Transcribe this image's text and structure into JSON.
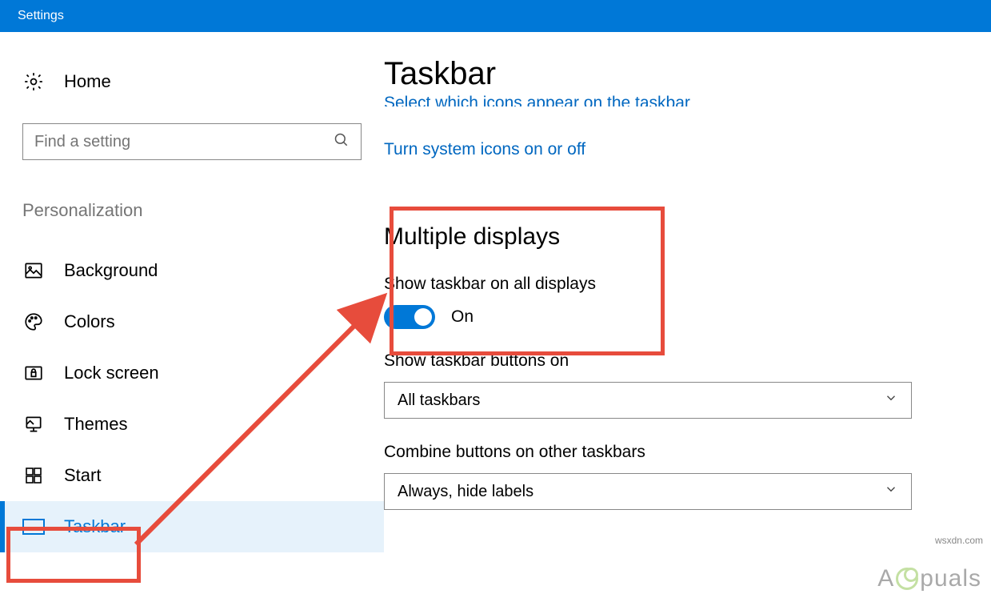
{
  "window": {
    "title": "Settings"
  },
  "sidebar": {
    "home": "Home",
    "search_placeholder": "Find a setting",
    "section": "Personalization",
    "items": [
      {
        "label": "Background"
      },
      {
        "label": "Colors"
      },
      {
        "label": "Lock screen"
      },
      {
        "label": "Themes"
      },
      {
        "label": "Start"
      },
      {
        "label": "Taskbar"
      }
    ]
  },
  "main": {
    "title": "Taskbar",
    "link_cropped": "Select which icons appear on the taskbar",
    "link_system_icons": "Turn system icons on or off",
    "section_multiple": "Multiple displays",
    "show_all_label": "Show taskbar on all displays",
    "toggle_state": "On",
    "show_buttons_label": "Show taskbar buttons on",
    "show_buttons_value": "All taskbars",
    "combine_label": "Combine buttons on other taskbars",
    "combine_value": "Always, hide labels"
  },
  "watermark": {
    "prefix": "A",
    "suffix": "puals"
  },
  "url_note": "wsxdn.com"
}
